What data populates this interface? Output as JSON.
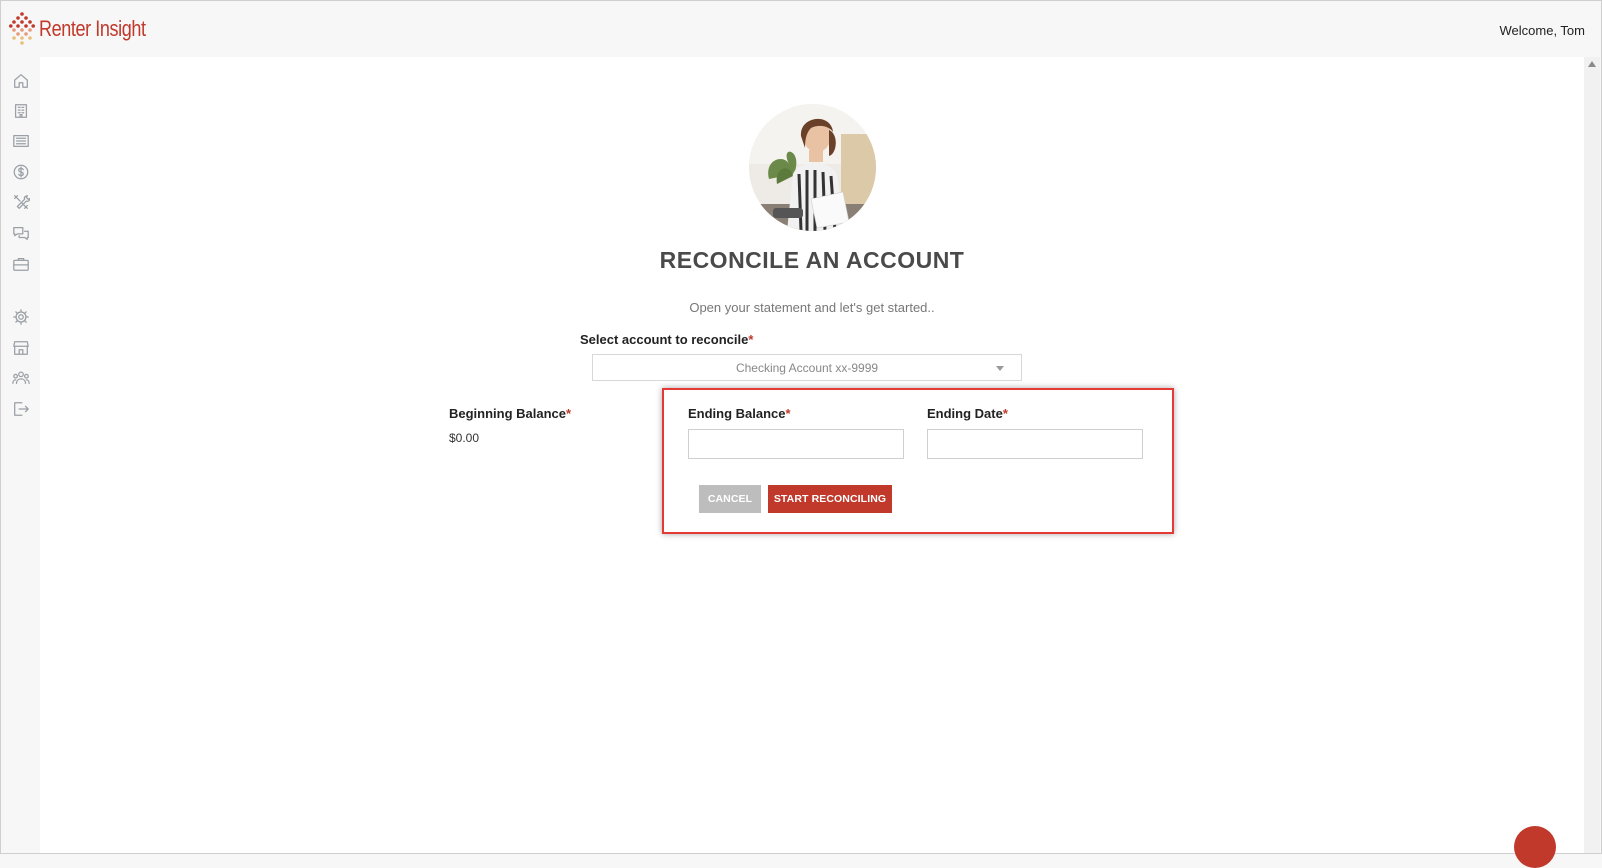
{
  "app": {
    "brand": "Renter Insight",
    "welcome": "Welcome, Tom",
    "brand_color": "#c0392b"
  },
  "sidebar": {
    "items": [
      {
        "icon": "home-icon"
      },
      {
        "icon": "building-icon"
      },
      {
        "icon": "list-icon"
      },
      {
        "icon": "dollar-icon"
      },
      {
        "icon": "tools-icon"
      },
      {
        "icon": "chat-icon"
      },
      {
        "icon": "briefcase-icon"
      },
      {
        "icon": "gear-icon"
      },
      {
        "icon": "store-icon"
      },
      {
        "icon": "users-icon"
      },
      {
        "icon": "logout-icon"
      }
    ]
  },
  "page": {
    "title": "RECONCILE AN ACCOUNT",
    "subtitle": "Open your statement and let's get started.."
  },
  "form": {
    "account_label": "Select account to reconcile",
    "account_selected": "Checking Account xx-9999",
    "required_mark": "*",
    "beginning_balance_label": "Beginning Balance",
    "beginning_balance_value": "$0.00",
    "ending_balance_label": "Ending Balance",
    "ending_balance_value": "",
    "ending_date_label": "Ending Date",
    "ending_date_value": "",
    "cancel_label": "CANCEL",
    "start_label": "START RECONCILING"
  }
}
